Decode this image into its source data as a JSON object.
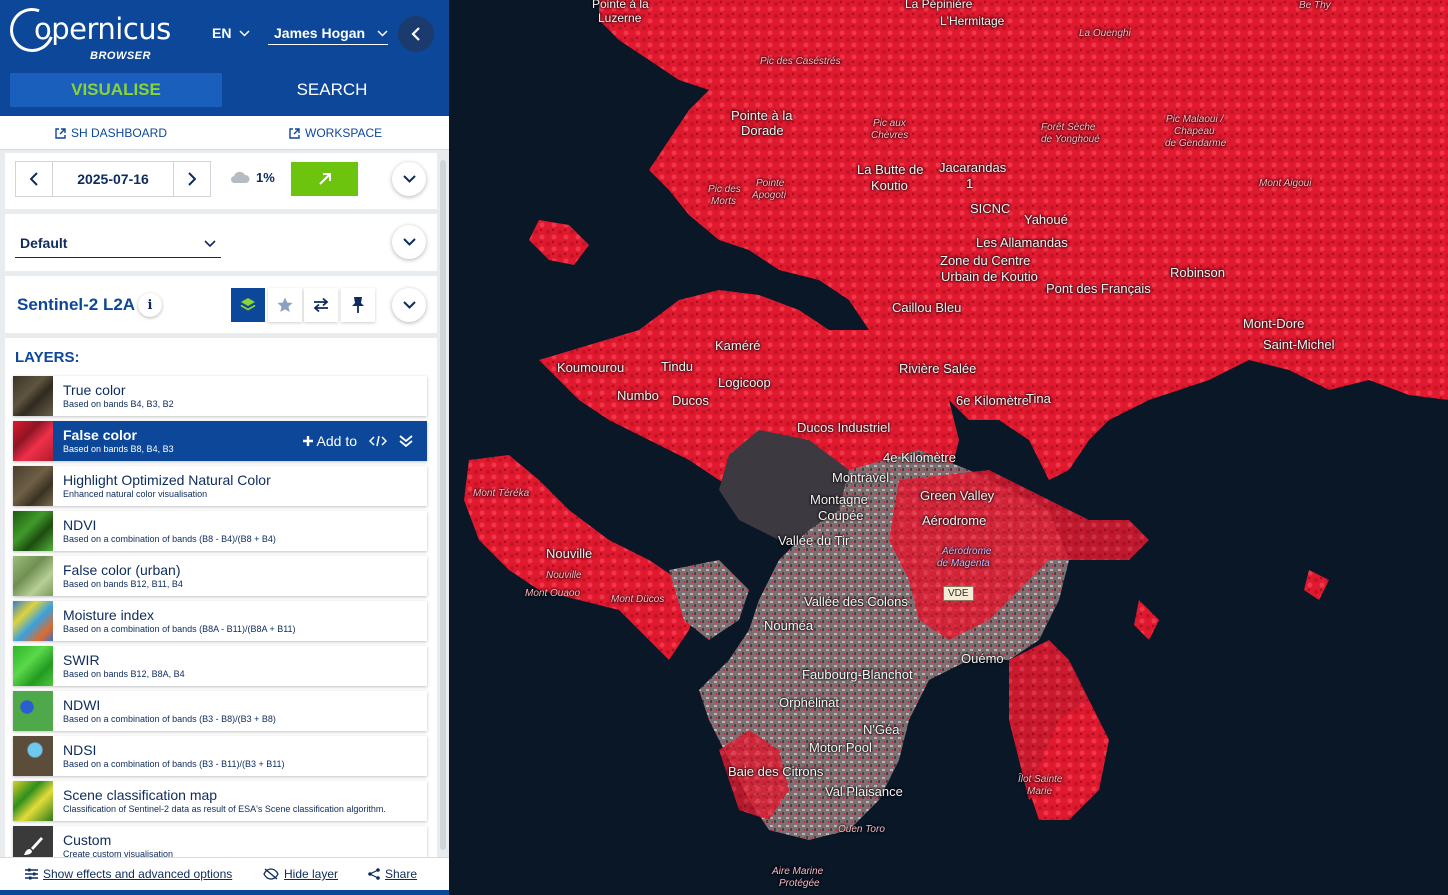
{
  "app": {
    "logo_main": "opernicus",
    "logo_sub": "BROWSER"
  },
  "header": {
    "language": "EN",
    "user": "James Hogan"
  },
  "tabs": {
    "visualise": "VISUALISE",
    "search": "SEARCH"
  },
  "links": {
    "dashboard": "SH DASHBOARD",
    "workspace": "WORKSPACE"
  },
  "date": {
    "value": "2025-07-16",
    "cloud": "1%"
  },
  "theme": {
    "selected": "Default"
  },
  "dataset": {
    "name": "Sentinel-2 L2A",
    "info": "i"
  },
  "layers": {
    "title": "LAYERS:",
    "add_to": "Add to",
    "items": [
      {
        "name": "True color",
        "desc": "Based on bands B4, B3, B2",
        "thumb": "#4a4233"
      },
      {
        "name": "False color",
        "desc": "Based on bands B8, B4, B3",
        "thumb": "#c81e36",
        "selected": true
      },
      {
        "name": "Highlight Optimized Natural Color",
        "desc": "Enhanced natural color visualisation",
        "thumb": "#5a4b38"
      },
      {
        "name": "NDVI",
        "desc": "Based on a combination of bands (B8 - B4)/(B8 + B4)",
        "thumb": "#2f7a1e"
      },
      {
        "name": "False color (urban)",
        "desc": "Based on bands B12, B11, B4",
        "thumb": "#8fb070"
      },
      {
        "name": "Moisture index",
        "desc": "Based on a combination of bands (B8A - B11)/(B8A + B11)",
        "thumb": "#3a9bd6"
      },
      {
        "name": "SWIR",
        "desc": "Based on bands B12, B8A, B4",
        "thumb": "#3dc23a"
      },
      {
        "name": "NDWI",
        "desc": "Based on a combination of bands (B3 - B8)/(B3 + B8)",
        "thumb": "#4fa84a"
      },
      {
        "name": "NDSI",
        "desc": "Based on a combination of bands (B3 - B11)/(B3 + B11)",
        "thumb": "#6b5a44"
      },
      {
        "name": "Scene classification map",
        "desc": "Classification of Sentinel-2 data as result of ESA's Scene classification algorithm.",
        "thumb": "#d8d02a"
      },
      {
        "name": "Custom",
        "desc": "Create custom visualisation",
        "thumb": "#3a3a3a"
      }
    ]
  },
  "bottom": {
    "effects": "Show effects and advanced options",
    "hide": "Hide layer",
    "share": "Share"
  },
  "map": {
    "places": [
      "Pointe à la",
      "Luzerne",
      "La Pépinière",
      "L'Hermitage",
      "La Ouenghi",
      "Be Thy",
      "Pic des Caséstrés",
      "Pointe à la",
      "Dorade",
      "Pic aux",
      "Chèvres",
      "Forêt Sèche",
      "de Yonghoué",
      "Pic Malaoui /",
      "Chapeau",
      "de Gendarme",
      "Pic des",
      "Morts",
      "Pointe",
      "Apogoti",
      "La Butte de",
      "Koutio",
      "Jacarandas",
      "1",
      "SICNC",
      "Yahoué",
      "Mont Aigoui",
      "Les Allamandas",
      "Zone du Centre",
      "Urbain de Koutio",
      "Pont des Français",
      "Robinson",
      "Mont-Dore",
      "Saint-Michel",
      "Caillou Bleu",
      "Kaméré",
      "Koumourou",
      "Tindu",
      "Logicoop",
      "Rivière Salée",
      "Numbo",
      "Ducos",
      "6e Kilomètre",
      "Tina",
      "Ducos Industriel",
      "4e Kilomètre",
      "Montravel",
      "Green Valley",
      "Montagne",
      "Coupée",
      "Aérodrome",
      "Mont Téréka",
      "Vallée du Tir",
      "Aérodrome",
      "de Magenta",
      "Nouville",
      "Nouville",
      "Mont Ouaoo",
      "Mont Dücos",
      "VDE",
      "Vallée des Colons",
      "Nouméa",
      "Ouémo",
      "Faubourg-Blanchot",
      "Orphelinat",
      "N'Géa",
      "Motor Pool",
      "Baie des Citrons",
      "Îlot Sainte",
      "Marie",
      "Val Plaisance",
      "Ouen Toro",
      "Aire Marine",
      "Protégée"
    ]
  },
  "colors": {
    "brand_blue": "#0d4799",
    "accent_green": "#6cc40f",
    "vis_tab_text": "#8ad434",
    "map_red": "#e0192f"
  },
  "icons": [
    "chevron-down-icon",
    "chevron-left-icon",
    "chevron-right-icon",
    "external-link-icon",
    "cloud-icon",
    "arrow-up-right-icon",
    "layers-icon",
    "star-icon",
    "compare-icon",
    "pin-icon",
    "plus-icon",
    "code-icon",
    "double-chevron-down-icon",
    "sliders-icon",
    "eye-off-icon",
    "share-icon"
  ]
}
